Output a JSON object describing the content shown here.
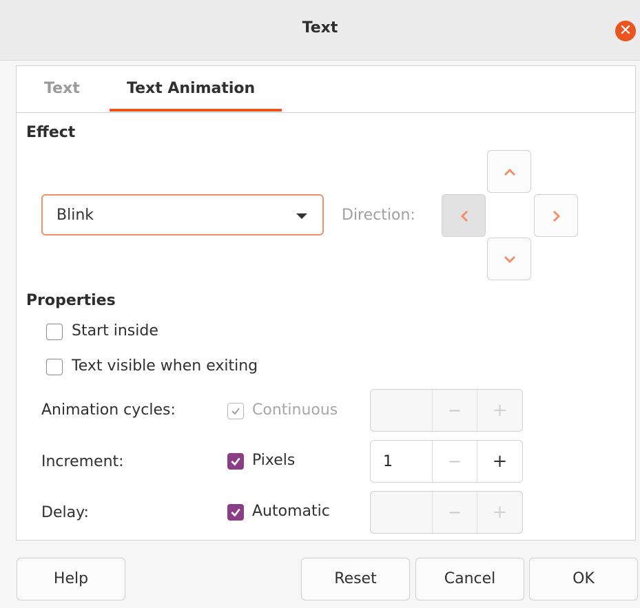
{
  "window": {
    "title": "Text",
    "close_icon": "close-icon"
  },
  "tabs": [
    {
      "label": "Text",
      "active": false
    },
    {
      "label": "Text Animation",
      "active": true
    }
  ],
  "effect": {
    "title": "Effect",
    "selected": "Blink",
    "direction_label": "Direction:"
  },
  "properties": {
    "title": "Properties",
    "start_inside": {
      "label": "Start inside",
      "checked": false
    },
    "text_visible": {
      "label": "Text visible when exiting",
      "checked": false
    },
    "animation_cycles": {
      "label": "Animation cycles:",
      "checkbox_label": "Continuous",
      "value": ""
    },
    "increment": {
      "label": "Increment:",
      "checkbox_label": "Pixels",
      "value": "1"
    },
    "delay": {
      "label": "Delay:",
      "checkbox_label": "Automatic",
      "value": ""
    }
  },
  "spin": {
    "minus": "−",
    "plus": "+"
  },
  "buttons": {
    "help": "Help",
    "reset": "Reset",
    "cancel": "Cancel",
    "ok": "OK"
  },
  "colors": {
    "accent": "#e95420",
    "checkbox_checked": "#8a3e85"
  }
}
